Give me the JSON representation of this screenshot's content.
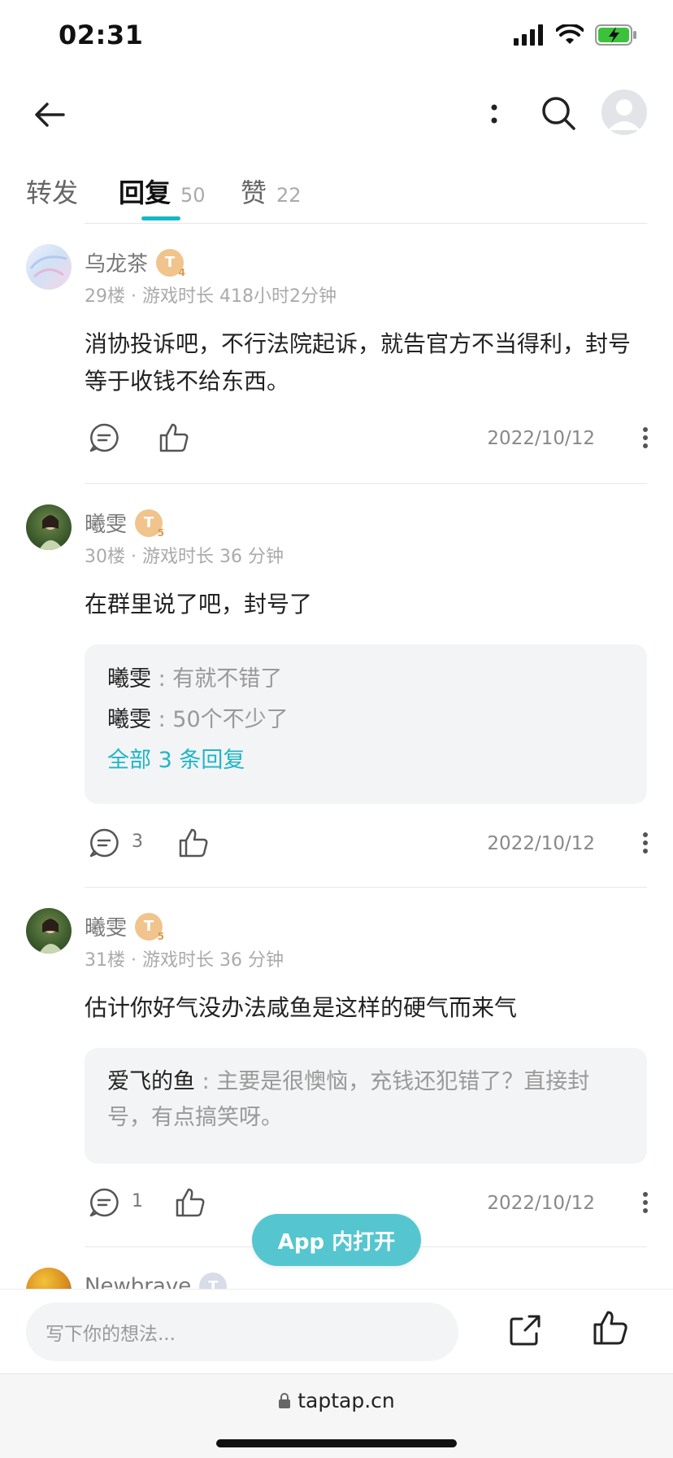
{
  "status_bar": {
    "time": "02:31"
  },
  "tabs": [
    {
      "label": "转发",
      "count": ""
    },
    {
      "label": "回复",
      "count": "50"
    },
    {
      "label": "赞",
      "count": "22"
    }
  ],
  "comments": [
    {
      "name": "乌龙茶",
      "badge": "T",
      "level": "4",
      "meta": "29楼 · 游戏时长 418小时2分钟",
      "body": "消协投诉吧，不行法院起诉，就告官方不当得利，封号等于收钱不给东西。",
      "comment_count": "",
      "date": "2022/10/12"
    },
    {
      "name": "曦雯",
      "badge": "T",
      "level": "5",
      "meta": "30楼 · 游戏时长 36 分钟",
      "body": "在群里说了吧，封号了",
      "replies": [
        {
          "name": "曦雯",
          "sep": " : ",
          "text": "有就不错了"
        },
        {
          "name": "曦雯",
          "sep": " : ",
          "text": "50个不少了"
        }
      ],
      "all_replies": "全部 3 条回复",
      "comment_count": "3",
      "date": "2022/10/12"
    },
    {
      "name": "曦雯",
      "badge": "T",
      "level": "5",
      "meta": "31楼 · 游戏时长 36 分钟",
      "body": "估计你好气没办法咸鱼是这样的硬气而来气",
      "replies": [
        {
          "name": "爱飞的鱼",
          "sep": " : ",
          "text": "主要是很懊恼，充钱还犯错了？直接封号，有点搞笑呀。"
        }
      ],
      "comment_count": "1",
      "date": "2022/10/12"
    },
    {
      "name": "Newbrave",
      "badge": "T"
    }
  ],
  "open_app_button": "App 内打开",
  "bottom_bar": {
    "input_placeholder": "写下你的想法..."
  },
  "url_bar": {
    "url": "taptap.cn"
  },
  "colors": {
    "accent": "#14b9c8",
    "open_app_bg": "#55c6cf",
    "badge": "#f0c48c"
  }
}
